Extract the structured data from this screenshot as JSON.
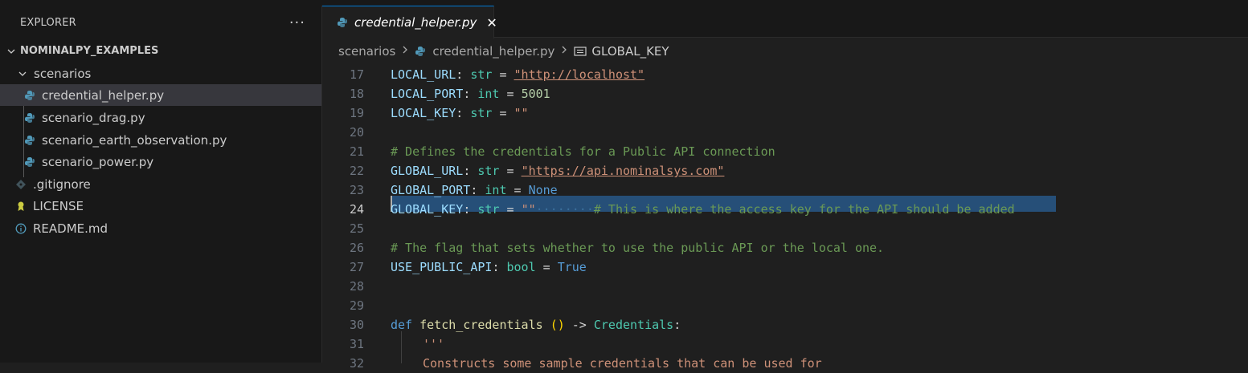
{
  "explorer": {
    "title": "EXPLORER",
    "more": "···",
    "root": "NOMINALPY_EXAMPLES",
    "folder": "scenarios",
    "folder_files": [
      "credential_helper.py",
      "scenario_drag.py",
      "scenario_earth_observation.py",
      "scenario_power.py"
    ],
    "root_files": [
      ".gitignore",
      "LICENSE",
      "README.md"
    ],
    "selected": "credential_helper.py"
  },
  "tab": {
    "label": "credential_helper.py",
    "close": "✕"
  },
  "breadcrumb": {
    "folder": "scenarios",
    "file": "credential_helper.py",
    "symbol": "GLOBAL_KEY"
  },
  "colors": {
    "accent": "#0078d4",
    "python_icon": "#519aba",
    "selection": "#264f78"
  },
  "code": {
    "active_line": 24,
    "line_numbers": [
      "17",
      "18",
      "19",
      "20",
      "21",
      "22",
      "23",
      "24",
      "25",
      "26",
      "27",
      "28",
      "29",
      "30",
      "31",
      "32"
    ],
    "l17": {
      "name": "LOCAL_URL",
      "type": "str",
      "value": "\"http://localhost\""
    },
    "l18": {
      "name": "LOCAL_PORT",
      "type": "int",
      "value": "5001"
    },
    "l19": {
      "name": "LOCAL_KEY",
      "type": "str",
      "value": "\"\""
    },
    "l21": "# Defines the credentials for a Public API connection",
    "l22": {
      "name": "GLOBAL_URL",
      "type": "str",
      "value": "\"https://api.nominalsys.com\""
    },
    "l23": {
      "name": "GLOBAL_PORT",
      "type": "int",
      "value": "None"
    },
    "l24": {
      "name": "GLOBAL_KEY",
      "type": "str",
      "value": "\"\"",
      "comment": "# This is where the access key for the API should be added"
    },
    "l26": "# The flag that sets whether to use the public API or the local one.",
    "l27": {
      "name": "USE_PUBLIC_API",
      "type": "bool",
      "value": "True"
    },
    "l30": {
      "keyword": "def",
      "func": "fetch_credentials",
      "parens": "()",
      "arrow": "->",
      "ret": "Credentials"
    },
    "l31": "'''",
    "l32": "Constructs some sample credentials that can be used for"
  }
}
